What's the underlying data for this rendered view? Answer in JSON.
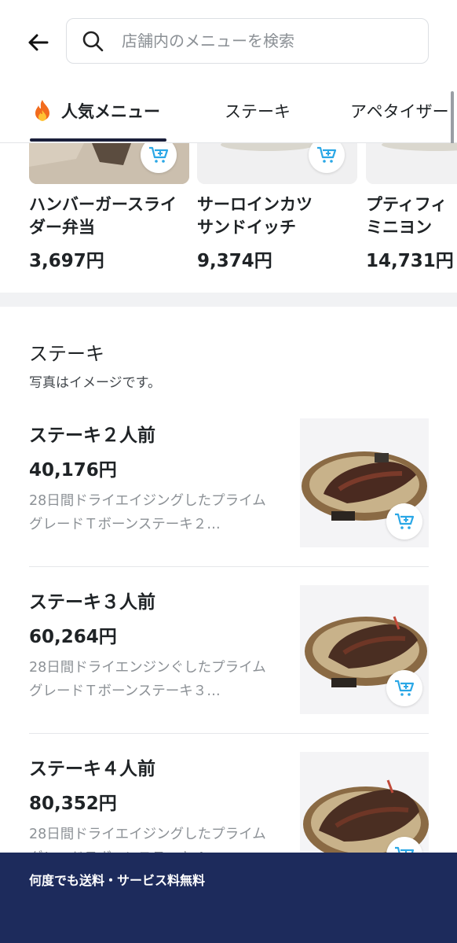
{
  "search": {
    "placeholder": "店舗内のメニューを検索",
    "value": ""
  },
  "tabs": [
    {
      "label": "人気メニュー",
      "active": true
    },
    {
      "label": "ステーキ",
      "active": false
    },
    {
      "label": "アペタイザー",
      "active": false
    }
  ],
  "popular": [
    {
      "name_line1": "ハンバーガースライ",
      "name_line2": "ダー弁当",
      "price": "3,697円"
    },
    {
      "name_line1": "サーロインカツ",
      "name_line2": "サンドイッチ",
      "price": "9,374円"
    },
    {
      "name_line1": "プティフィ",
      "name_line2": "ミニヨン",
      "price": "14,731円"
    }
  ],
  "section": {
    "title": "ステーキ",
    "subtitle": "写真はイメージです。"
  },
  "items": [
    {
      "name": "ステーキ２人前",
      "price": "40,176円",
      "desc": "28日間ドライエイジングしたプライムグレードＴボーンステーキ２…"
    },
    {
      "name": "ステーキ３人前",
      "price": "60,264円",
      "desc": "28日間ドライエンジンぐしたプライムグレードＴボーンステーキ３…"
    },
    {
      "name": "ステーキ４人前",
      "price": "80,352円",
      "desc": "28日間ドライエイジングしたプライムグレードＴボーンステーキ４…"
    }
  ],
  "footer": {
    "text": "何度でも送料・サービス料無料"
  },
  "colors": {
    "accent": "#1d2b5c",
    "cart_icon": "#2aa7e6",
    "muted_text": "#8c9196"
  }
}
